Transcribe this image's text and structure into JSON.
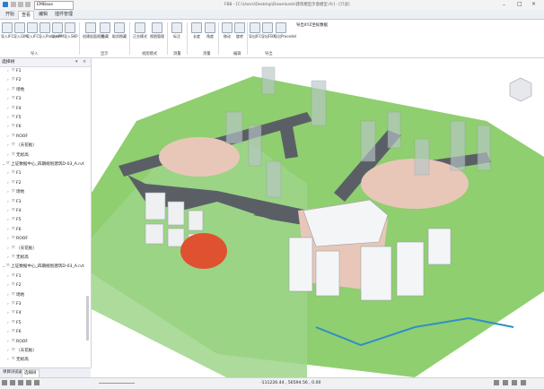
{
  "window": {
    "app_name": "EMBase",
    "title": "FBB - [C:\\Users\\Desktop\\Downloads\\建筑模型示意模型.ifc] - [只读]"
  },
  "tabs": [
    {
      "label": "开始"
    },
    {
      "label": "查看"
    },
    {
      "label": "编辑"
    },
    {
      "label": "插件管理"
    }
  ],
  "ribbon": {
    "buttons": [
      {
        "label": "导入IFC"
      },
      {
        "label": "导入GIM"
      },
      {
        "label": "导入IFC"
      },
      {
        "label": "导入Procedel"
      },
      {
        "label": "导入PM"
      },
      {
        "label": "导入SKP"
      },
      {
        "label": "创建剖面视图"
      },
      {
        "label": "隐藏"
      },
      {
        "label": "取消隐藏"
      },
      {
        "label": "正交模式"
      },
      {
        "label": "视图管理"
      },
      {
        "label": "标注"
      },
      {
        "label": "长度"
      },
      {
        "label": "角度"
      },
      {
        "label": "移动"
      },
      {
        "label": "旋转"
      },
      {
        "label": "导出IFC"
      },
      {
        "label": "导出FBX"
      },
      {
        "label": "导出Procedel"
      }
    ],
    "extra_label": "导出XYZ坐标数据",
    "groups": [
      "导入",
      "显示",
      "视图模式",
      "测量",
      "测量",
      "编辑",
      "导出"
    ]
  },
  "sidebar": {
    "title": "选择树",
    "items": [
      {
        "label": "F1",
        "indent": 1
      },
      {
        "label": "F2",
        "indent": 1
      },
      {
        "label": "场地",
        "indent": 1
      },
      {
        "label": "F3",
        "indent": 1
      },
      {
        "label": "F4",
        "indent": 1
      },
      {
        "label": "F5",
        "indent": 1
      },
      {
        "label": "F6",
        "indent": 1
      },
      {
        "label": "ROOF",
        "indent": 1
      },
      {
        "label": "（天花板）",
        "indent": 1
      },
      {
        "label": "无标高",
        "indent": 1
      },
      {
        "label": "上证数据中心_四期规划建筑D-03_A.rvt",
        "indent": 0
      },
      {
        "label": "F1",
        "indent": 1
      },
      {
        "label": "F2",
        "indent": 1
      },
      {
        "label": "场地",
        "indent": 1
      },
      {
        "label": "F3",
        "indent": 1
      },
      {
        "label": "F4",
        "indent": 1
      },
      {
        "label": "F5",
        "indent": 1
      },
      {
        "label": "F6",
        "indent": 1
      },
      {
        "label": "ROOF",
        "indent": 1
      },
      {
        "label": "（天花板）",
        "indent": 1
      },
      {
        "label": "无标高",
        "indent": 1
      },
      {
        "label": "上证数据中心_四期规划建筑D-03_A.rvt",
        "indent": 0
      },
      {
        "label": "F1",
        "indent": 1
      },
      {
        "label": "F2",
        "indent": 1
      },
      {
        "label": "场地",
        "indent": 1
      },
      {
        "label": "F3",
        "indent": 1
      },
      {
        "label": "F4",
        "indent": 1
      },
      {
        "label": "F5",
        "indent": 1
      },
      {
        "label": "F6",
        "indent": 1
      },
      {
        "label": "ROOF",
        "indent": 1
      },
      {
        "label": "（天花板）",
        "indent": 1
      },
      {
        "label": "无标高",
        "indent": 1
      }
    ],
    "bottom_tabs": [
      "项目浏览器",
      "选择树"
    ]
  },
  "statusbar": {
    "coords": "-111226.44 , 56594.56 , 0.00"
  },
  "colors": {
    "ground": "#8fcf6f",
    "road": "#5a5f66",
    "plaza": "#e8c7b8",
    "track": "#e0512f",
    "water": "#2f8fc8"
  }
}
